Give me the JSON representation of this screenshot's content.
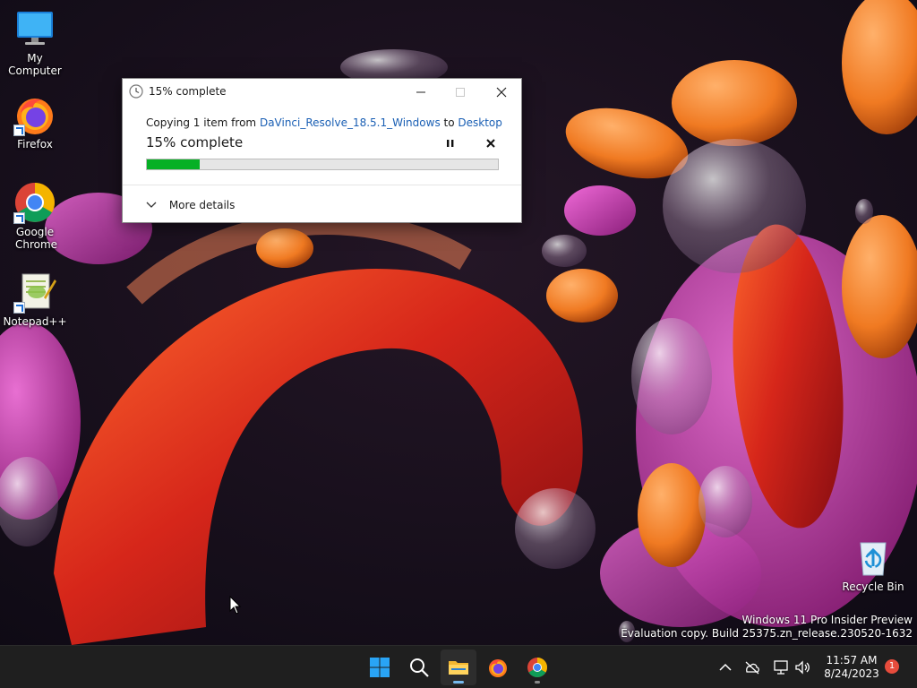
{
  "desktop": {
    "icons": [
      {
        "label": "My Computer",
        "icon": "monitor-icon"
      },
      {
        "label": "Firefox",
        "icon": "firefox-icon"
      },
      {
        "label": "Google Chrome",
        "icon": "chrome-icon"
      },
      {
        "label": "Notepad++",
        "icon": "notepadpp-icon"
      },
      {
        "label": "Recycle Bin",
        "icon": "recycle-bin-icon"
      }
    ],
    "watermark": {
      "line1": "Windows 11 Pro Insider Preview",
      "line2": "Evaluation copy. Build 25375.zn_release.230520-1632"
    }
  },
  "copy_dialog": {
    "title": "15% complete",
    "copy_prefix": "Copying 1 item from",
    "source": "DaVinci_Resolve_18.5.1_Windows",
    "to_word": "to",
    "destination": "Desktop",
    "progress_heading": "15% complete",
    "progress_fraction": 0.15,
    "more_details": "More details",
    "caption_buttons": [
      "minimize",
      "maximize",
      "close"
    ]
  },
  "taskbar": {
    "apps": [
      {
        "name": "start",
        "icon": "windows-start-icon"
      },
      {
        "name": "search",
        "icon": "search-icon"
      },
      {
        "name": "file-explorer",
        "icon": "folder-icon",
        "active": true
      },
      {
        "name": "firefox",
        "icon": "firefox-icon"
      },
      {
        "name": "chrome",
        "icon": "chrome-icon",
        "running": true
      }
    ],
    "tray": {
      "time": "11:57 AM",
      "date": "8/24/2023",
      "notification_count": "1"
    }
  },
  "colors": {
    "progress_green": "#06b025",
    "link_blue": "#1a5fb4",
    "taskbar_bg": "#1f1f1f"
  }
}
